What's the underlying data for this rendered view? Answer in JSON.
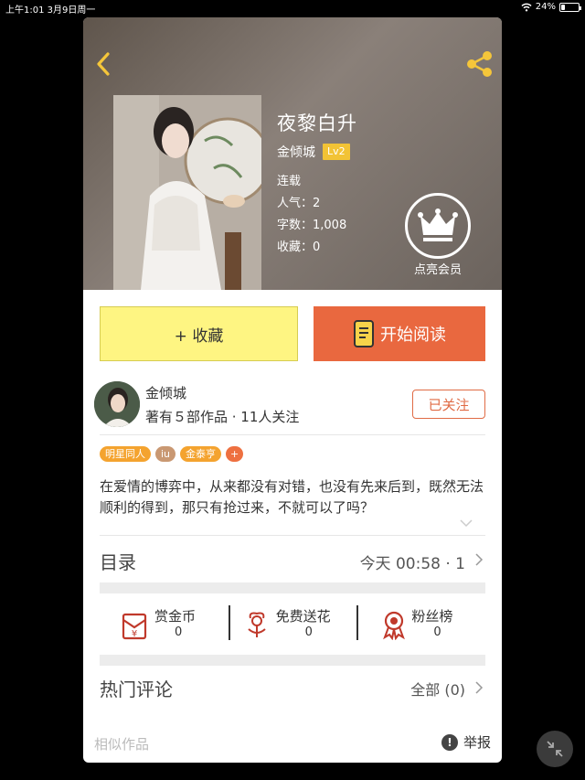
{
  "status_bar": {
    "time": "上午1:01",
    "date": "3月9日周一",
    "battery": "24%",
    "battery_level": 0.24
  },
  "header": {
    "back_icon": "chevron-left-icon",
    "share_icon": "share-icon"
  },
  "book": {
    "title": "夜黎白升",
    "author": "金倾城",
    "level": "Lv2",
    "status": "连载",
    "popularity": "人气：2",
    "word_count": "字数：1,008",
    "favorites": "收藏：0",
    "vip_label": "点亮会员"
  },
  "actions": {
    "favorite_label": "+ 收藏",
    "read_label": "开始阅读"
  },
  "author": {
    "name": "金倾城",
    "stats": "著有５部作品 · 11人关注",
    "follow_label": "已关注"
  },
  "tags": [
    "明星同人",
    "iu",
    "金泰亨",
    "+"
  ],
  "description": "在爱情的博弈中，从来都没有对错，也没有先来后到，既然无法顺利的得到，那只有抢过来，不就可以了吗？",
  "toc": {
    "label": "目录",
    "update": "今天 00:58 · 1"
  },
  "rewards": [
    {
      "label": "赏金币",
      "value": "0",
      "icon": "red-envelope-icon"
    },
    {
      "label": "免费送花",
      "value": "0",
      "icon": "flower-icon"
    },
    {
      "label": "粉丝榜",
      "value": "0",
      "icon": "medal-icon"
    }
  ],
  "comments": {
    "label": "热门评论",
    "all_label": "全部 (0)"
  },
  "footer": {
    "similar_label": "相似作品",
    "report_label": "举报"
  },
  "colors": {
    "accent_orange": "#e9683f",
    "favorite_yellow": "#fef582",
    "level_badge": "#f2c335",
    "tag_orange": "#f4a32f",
    "icon_red": "#c0392b"
  }
}
